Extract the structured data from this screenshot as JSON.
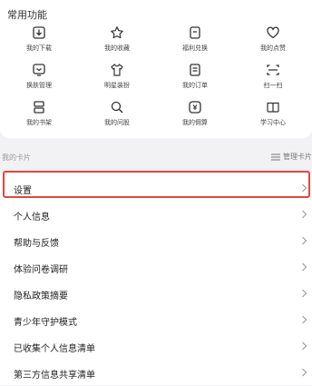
{
  "section": {
    "title": "常用功能"
  },
  "features": [
    {
      "label": "我的下载",
      "icon": "download-icon"
    },
    {
      "label": "我的收藏",
      "icon": "star-icon"
    },
    {
      "label": "福利兑换",
      "icon": "gift-box-icon"
    },
    {
      "label": "我的点赞",
      "icon": "heart-icon"
    },
    {
      "label": "换肤管理",
      "icon": "skin-icon"
    },
    {
      "label": "明星装扮",
      "icon": "shirt-icon"
    },
    {
      "label": "我的订单",
      "icon": "order-icon"
    },
    {
      "label": "扫一扫",
      "icon": "scan-icon"
    },
    {
      "label": "我的书架",
      "icon": "bookshelf-icon"
    },
    {
      "label": "我的问股",
      "icon": "search-icon"
    },
    {
      "label": "我的佣算",
      "icon": "wallet-icon"
    },
    {
      "label": "学习中心",
      "icon": "book-icon"
    }
  ],
  "cards": {
    "title": "我的卡片",
    "manage_label": "管理卡片"
  },
  "settings": [
    {
      "label": "设置"
    },
    {
      "label": "个人信息"
    },
    {
      "label": "帮助与反馈"
    },
    {
      "label": "体验问卷调研"
    },
    {
      "label": "隐私政策摘要"
    },
    {
      "label": "青少年守护模式"
    },
    {
      "label": "已收集个人信息清单"
    },
    {
      "label": "第三方信息共享清单"
    }
  ],
  "colors": {
    "highlight": "#e0483c",
    "background": "#f2f2f4"
  }
}
